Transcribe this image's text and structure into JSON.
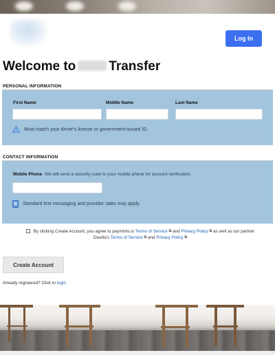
{
  "header": {
    "login_label": "Log In"
  },
  "title": {
    "prefix": "Welcome to",
    "suffix": "Transfer"
  },
  "personal": {
    "section_label": "PERSONAL INFORMATION",
    "first_name_label": "First Name",
    "middle_name_label": "Middle Name",
    "last_name_label": "Last Name",
    "first_name_value": "",
    "middle_name_value": "",
    "last_name_value": "",
    "note": "Must match your driver's license or government-issued ID."
  },
  "contact": {
    "section_label": "CONTACT INFORMATION",
    "mobile_label": "Mobile Phone",
    "mobile_hint": "We will send a security code to your mobile phone for account verification.",
    "mobile_value": "",
    "note": "Standard text messaging and provider rates may apply."
  },
  "consent": {
    "text_1": "By clicking Create Account, you agree to paymints.io",
    "terms_1": "Terms of Service",
    "and_1": "and",
    "privacy_1": "Privacy Policy",
    "text_2": "as well as our partner Dwolla's",
    "terms_2": "Terms of Service",
    "and_2": "and",
    "privacy_2": "Privacy Policy",
    "checked": false
  },
  "actions": {
    "create_label": "Create Account",
    "registered_text": "Already registered? Click to",
    "login_link": "login"
  },
  "colors": {
    "primary_button": "#3b6ff0",
    "panel": "#a2c5dd",
    "link": "#1a5fb4"
  }
}
